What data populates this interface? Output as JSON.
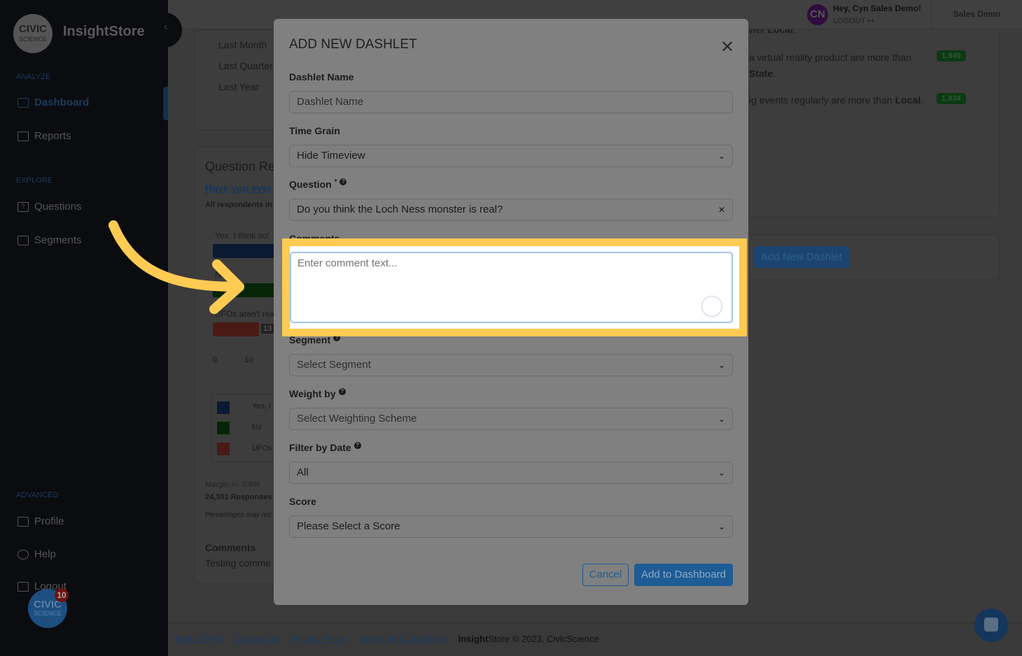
{
  "app": {
    "brand": "InsightStore",
    "logo_line1": "CIVIC",
    "logo_line2": "SCIENCE"
  },
  "sidebar": {
    "sections": [
      {
        "label": "ANALYZE"
      },
      {
        "label": "EXPLORE"
      },
      {
        "label": "ADVANCED"
      }
    ],
    "items": [
      {
        "label": "Dashboard",
        "icon": "dashboard-icon",
        "active": true
      },
      {
        "label": "Reports",
        "icon": "report-icon"
      },
      {
        "label": "Questions",
        "icon": "question-icon"
      },
      {
        "label": "Segments",
        "icon": "segments-icon"
      },
      {
        "label": "Profile",
        "icon": "profile-icon"
      },
      {
        "label": "Help",
        "icon": "lifebuoy-icon"
      },
      {
        "label": "Logout",
        "icon": "logout-icon"
      }
    ],
    "notification_count": "10"
  },
  "header": {
    "avatar_initials": "CN",
    "greeting": "Hey, Cyn Sales Demo!",
    "logout": "LOGOUT",
    "account": "Sales Demo"
  },
  "background": {
    "time_options": [
      "Last Month",
      "Last Quarter",
      "Last Year"
    ],
    "question_title": "Question Re",
    "question_link": "Have you ever",
    "respondents": "All respondents in",
    "answers": [
      "Yes, I think so!",
      "No",
      "UFOs aren't rea"
    ],
    "bar_label": "13",
    "axis": [
      "0",
      "10"
    ],
    "legend": [
      "Yes, I",
      "No",
      "UFOs"
    ],
    "margin": "Margin +/- 0.6%",
    "responses": "24,301 Responses",
    "note": "Percentages may not",
    "comments_title": "Comments",
    "comments_text": "Testing comme",
    "insights": [
      {
        "text": "wer ",
        "bold": "Local",
        "end": "."
      },
      {
        "text": "a virtual reality product are more than",
        "bold": "State",
        "end": ".",
        "score": "1.940"
      },
      {
        "text": "ig events regularly are more than",
        "bold": "Local",
        "end": ".",
        "score": "1.934"
      }
    ],
    "add_new_dashlet": "Add New Dashlet"
  },
  "modal": {
    "title": "ADD NEW DASHLET",
    "dashlet_name_label": "Dashlet Name",
    "dashlet_name_placeholder": "Dashlet Name",
    "time_grain_label": "Time Grain",
    "time_grain_value": "Hide Timeview",
    "question_label": "Question",
    "question_value": "Do you think the Loch Ness monster is real?",
    "comments_label": "Comments",
    "comments_placeholder": "Enter comment text...",
    "segment_label": "Segment",
    "segment_value": "Select Segment",
    "weight_label": "Weight by",
    "weight_value": "Select Weighting Scheme",
    "filter_date_label": "Filter by Date",
    "filter_date_value": "All",
    "score_label": "Score",
    "score_value": "Please Select a Score",
    "cancel": "Cancel",
    "submit": "Add to Dashboard"
  },
  "footer": {
    "links": [
      "Help & FAQ",
      "Contact Us",
      "Privacy Policy",
      "Terms and Conditions"
    ],
    "brand_bold": "Insight",
    "brand_rest": "Store © 2023, CivicScience"
  },
  "colors": {
    "highlight": "#ffcb52",
    "primary": "#1f5c96",
    "score_badge": "#0c3a12"
  }
}
